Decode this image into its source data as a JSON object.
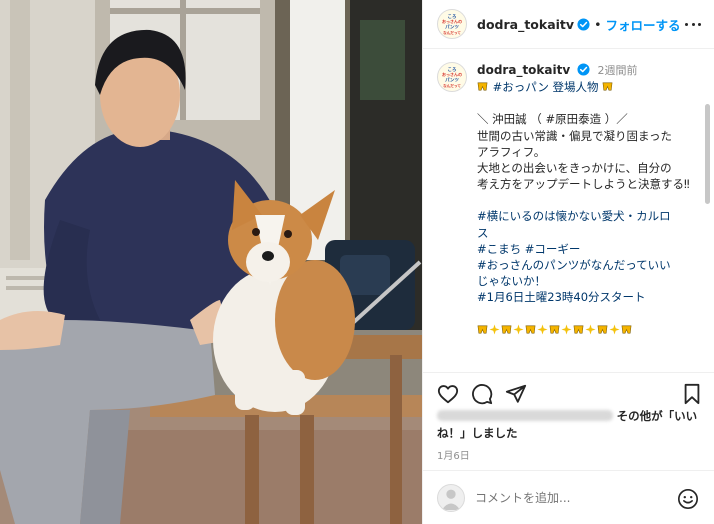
{
  "header": {
    "username": "dodra_tokaitv",
    "follow_label": "フォローする",
    "separator": "•"
  },
  "logo": {
    "lines": [
      "ころ",
      "おっさんの",
      "パンツ",
      "なんだって"
    ]
  },
  "caption": {
    "username": "dodra_tokaitv",
    "time": "2週間前",
    "title": "#おっパン 登場人物",
    "line1": "＼ 沖田誠 （ #原田泰造 ）／",
    "line2": "世間の古い常識・偏見で凝り固まった",
    "line3": "アラフィフ。",
    "line4": "大地との出会いをきっかけに、自分の",
    "line5": "考え方をアップデートしようと決意する‼",
    "line6": "#横にいるのは懐かない愛犬・カルロ",
    "line7": "ス",
    "line8": "#こまち #コーギー",
    "line9": "#おっさんのパンツがなんだっていい",
    "line10": "じゃないか！",
    "line11": "#1月6日土曜23時40分スタート"
  },
  "likes": {
    "text1": "その他が「いい",
    "text2": "ね！」しました"
  },
  "date": "1月6日",
  "comment": {
    "placeholder": "コメントを追加..."
  },
  "colors": {
    "accent": "#0095f6",
    "hashtag": "#00376b",
    "muted": "#8e8e8e"
  },
  "icons": [
    "heart-icon",
    "comment-icon",
    "share-icon",
    "bookmark-icon",
    "more-icon",
    "verified-icon",
    "smile-icon",
    "underpants-emoji",
    "sparkle-emoji"
  ]
}
